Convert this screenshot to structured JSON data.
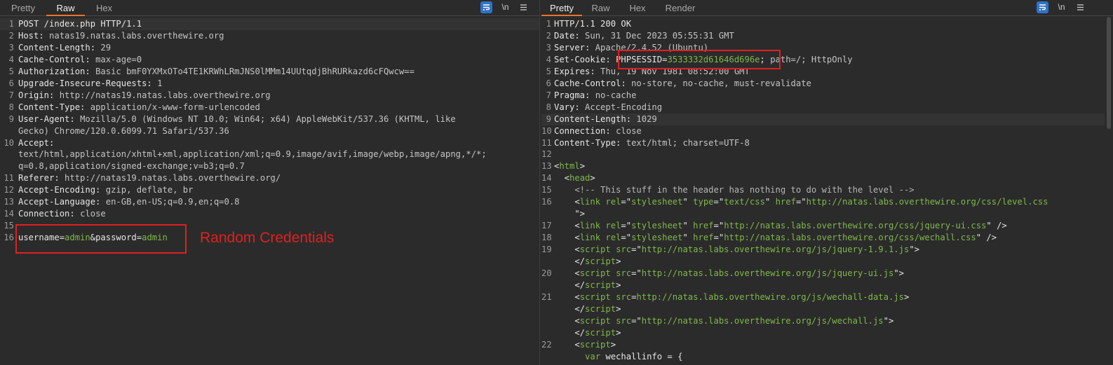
{
  "left": {
    "tabs": [
      "Pretty",
      "Raw",
      "Hex"
    ],
    "active_tab": "Raw",
    "toolbar": {
      "wrap_icon": "wrap-lines-icon",
      "newline_label": "\\n",
      "menu_icon": "hamburger-icon"
    },
    "lines": [
      {
        "n": "1",
        "parts": [
          [
            "k",
            "POST /index.php HTTP/1.1"
          ]
        ]
      },
      {
        "n": "2",
        "parts": [
          [
            "k",
            "Host: "
          ],
          [
            "v",
            "natas19.natas.labs.overthewire.org"
          ]
        ]
      },
      {
        "n": "3",
        "parts": [
          [
            "k",
            "Content-Length: "
          ],
          [
            "v",
            "29"
          ]
        ]
      },
      {
        "n": "4",
        "parts": [
          [
            "k",
            "Cache-Control: "
          ],
          [
            "v",
            "max-age=0"
          ]
        ]
      },
      {
        "n": "5",
        "parts": [
          [
            "k",
            "Authorization: "
          ],
          [
            "v",
            "Basic bmF0YXMxOTo4TE1KRWhLRmJNS0lMMm14UUtqdjBhRURkazd6cFQwcw=="
          ]
        ]
      },
      {
        "n": "6",
        "parts": [
          [
            "k",
            "Upgrade-Insecure-Requests: "
          ],
          [
            "v",
            "1"
          ]
        ]
      },
      {
        "n": "7",
        "parts": [
          [
            "k",
            "Origin: "
          ],
          [
            "v",
            "http://natas19.natas.labs.overthewire.org"
          ]
        ]
      },
      {
        "n": "8",
        "parts": [
          [
            "k",
            "Content-Type: "
          ],
          [
            "v",
            "application/x-www-form-urlencoded"
          ]
        ]
      },
      {
        "n": "9",
        "parts": [
          [
            "k",
            "User-Agent: "
          ],
          [
            "v",
            "Mozilla/5.0 (Windows NT 10.0; Win64; x64) AppleWebKit/537.36 (KHTML, like"
          ]
        ]
      },
      {
        "n": "",
        "parts": [
          [
            "v",
            "Gecko) Chrome/120.0.6099.71 Safari/537.36"
          ]
        ]
      },
      {
        "n": "10",
        "parts": [
          [
            "k",
            "Accept:"
          ]
        ]
      },
      {
        "n": "",
        "parts": [
          [
            "v",
            "text/html,application/xhtml+xml,application/xml;q=0.9,image/avif,image/webp,image/apng,*/*;"
          ]
        ]
      },
      {
        "n": "",
        "parts": [
          [
            "v",
            "q=0.8,application/signed-exchange;v=b3;q=0.7"
          ]
        ]
      },
      {
        "n": "11",
        "parts": [
          [
            "k",
            "Referer: "
          ],
          [
            "v",
            "http://natas19.natas.labs.overthewire.org/"
          ]
        ]
      },
      {
        "n": "12",
        "parts": [
          [
            "k",
            "Accept-Encoding: "
          ],
          [
            "v",
            "gzip, deflate, br"
          ]
        ]
      },
      {
        "n": "13",
        "parts": [
          [
            "k",
            "Accept-Language: "
          ],
          [
            "v",
            "en-GB,en-US;q=0.9,en;q=0.8"
          ]
        ]
      },
      {
        "n": "14",
        "parts": [
          [
            "k",
            "Connection: "
          ],
          [
            "v",
            "close"
          ]
        ]
      },
      {
        "n": "15",
        "parts": []
      },
      {
        "n": "16",
        "parts": [
          [
            "k",
            "username"
          ],
          [
            "t",
            "="
          ],
          [
            "g",
            "admin"
          ],
          [
            "t",
            "&password="
          ],
          [
            "g",
            "admin"
          ]
        ]
      }
    ],
    "annotation": "Random Credentials"
  },
  "right": {
    "tabs": [
      "Pretty",
      "Raw",
      "Hex",
      "Render"
    ],
    "active_tab": "Pretty",
    "toolbar": {
      "wrap_icon": "wrap-lines-icon",
      "newline_label": "\\n",
      "menu_icon": "hamburger-icon"
    },
    "lines": [
      {
        "n": "1",
        "parts": [
          [
            "k",
            "HTTP/1.1 200 OK"
          ]
        ]
      },
      {
        "n": "2",
        "parts": [
          [
            "k",
            "Date: "
          ],
          [
            "v",
            "Sun, 31 Dec 2023 05:55:31 GMT"
          ]
        ]
      },
      {
        "n": "3",
        "parts": [
          [
            "k",
            "Server: "
          ],
          [
            "v",
            "Apache/2.4.52 (Ubuntu)"
          ]
        ]
      },
      {
        "n": "4",
        "parts": [
          [
            "k",
            "Set-Cookie: "
          ],
          [
            "k",
            "PHPSESSID="
          ],
          [
            "g",
            "3533332d61646d696e"
          ],
          [
            "k",
            "; "
          ],
          [
            "v",
            "path=/; HttpOnly"
          ]
        ]
      },
      {
        "n": "5",
        "parts": [
          [
            "k",
            "Expires: "
          ],
          [
            "v",
            "Thu, 19 Nov 1981 08:52:00 GMT"
          ]
        ]
      },
      {
        "n": "6",
        "parts": [
          [
            "k",
            "Cache-Control: "
          ],
          [
            "v",
            "no-store, no-cache, must-revalidate"
          ]
        ]
      },
      {
        "n": "7",
        "parts": [
          [
            "k",
            "Pragma: "
          ],
          [
            "v",
            "no-cache"
          ]
        ]
      },
      {
        "n": "8",
        "parts": [
          [
            "k",
            "Vary: "
          ],
          [
            "v",
            "Accept-Encoding"
          ]
        ]
      },
      {
        "n": "9",
        "parts": [
          [
            "k",
            "Content-Length: "
          ],
          [
            "v",
            "1029"
          ]
        ]
      },
      {
        "n": "10",
        "parts": [
          [
            "k",
            "Connection: "
          ],
          [
            "v",
            "close"
          ]
        ]
      },
      {
        "n": "11",
        "parts": [
          [
            "k",
            "Content-Type: "
          ],
          [
            "v",
            "text/html; charset=UTF-8"
          ]
        ]
      },
      {
        "n": "12",
        "parts": []
      },
      {
        "n": "13",
        "parts": [
          [
            "t",
            "<"
          ],
          [
            "g",
            "html"
          ],
          [
            "t",
            ">"
          ]
        ]
      },
      {
        "n": "14",
        "parts": [
          [
            "t",
            "  <"
          ],
          [
            "g",
            "head"
          ],
          [
            "t",
            ">"
          ]
        ]
      },
      {
        "n": "15",
        "parts": [
          [
            "cm",
            "    <!-- This stuff in the header has nothing to do with the level -->"
          ]
        ]
      },
      {
        "n": "16",
        "parts": [
          [
            "t",
            "    <"
          ],
          [
            "g",
            "link"
          ],
          [
            "t",
            " "
          ],
          [
            "g",
            "rel"
          ],
          [
            "t",
            "=\""
          ],
          [
            "g",
            "stylesheet"
          ],
          [
            "t",
            "\" "
          ],
          [
            "g",
            "type"
          ],
          [
            "t",
            "=\""
          ],
          [
            "g",
            "text/css"
          ],
          [
            "t",
            "\" "
          ],
          [
            "g",
            "href"
          ],
          [
            "t",
            "=\""
          ],
          [
            "g",
            "http://natas.labs.overthewire.org/css/level.css"
          ]
        ]
      },
      {
        "n": "",
        "parts": [
          [
            "t",
            "    \">"
          ]
        ]
      },
      {
        "n": "17",
        "parts": [
          [
            "t",
            "    <"
          ],
          [
            "g",
            "link"
          ],
          [
            "t",
            " "
          ],
          [
            "g",
            "rel"
          ],
          [
            "t",
            "=\""
          ],
          [
            "g",
            "stylesheet"
          ],
          [
            "t",
            "\" "
          ],
          [
            "g",
            "href"
          ],
          [
            "t",
            "=\""
          ],
          [
            "g",
            "http://natas.labs.overthewire.org/css/jquery-ui.css"
          ],
          [
            "t",
            "\" />"
          ]
        ]
      },
      {
        "n": "18",
        "parts": [
          [
            "t",
            "    <"
          ],
          [
            "g",
            "link"
          ],
          [
            "t",
            " "
          ],
          [
            "g",
            "rel"
          ],
          [
            "t",
            "=\""
          ],
          [
            "g",
            "stylesheet"
          ],
          [
            "t",
            "\" "
          ],
          [
            "g",
            "href"
          ],
          [
            "t",
            "=\""
          ],
          [
            "g",
            "http://natas.labs.overthewire.org/css/wechall.css"
          ],
          [
            "t",
            "\" />"
          ]
        ]
      },
      {
        "n": "19",
        "parts": [
          [
            "t",
            "    <"
          ],
          [
            "g",
            "script"
          ],
          [
            "t",
            " "
          ],
          [
            "g",
            "src"
          ],
          [
            "t",
            "=\""
          ],
          [
            "g",
            "http://natas.labs.overthewire.org/js/jquery-1.9.1.js"
          ],
          [
            "t",
            "\">"
          ]
        ]
      },
      {
        "n": "",
        "parts": [
          [
            "t",
            "    </"
          ],
          [
            "g",
            "script"
          ],
          [
            "t",
            ">"
          ]
        ]
      },
      {
        "n": "20",
        "parts": [
          [
            "t",
            "    <"
          ],
          [
            "g",
            "script"
          ],
          [
            "t",
            " "
          ],
          [
            "g",
            "src"
          ],
          [
            "t",
            "=\""
          ],
          [
            "g",
            "http://natas.labs.overthewire.org/js/jquery-ui.js"
          ],
          [
            "t",
            "\">"
          ]
        ]
      },
      {
        "n": "",
        "parts": [
          [
            "t",
            "    </"
          ],
          [
            "g",
            "script"
          ],
          [
            "t",
            ">"
          ]
        ]
      },
      {
        "n": "21",
        "parts": [
          [
            "t",
            "    <"
          ],
          [
            "g",
            "script"
          ],
          [
            "t",
            " "
          ],
          [
            "g",
            "src"
          ],
          [
            "t",
            "="
          ],
          [
            "g",
            "http://natas.labs.overthewire.org/js/wechall-data.js"
          ],
          [
            "t",
            ">"
          ]
        ]
      },
      {
        "n": "",
        "parts": [
          [
            "t",
            "    </"
          ],
          [
            "g",
            "script"
          ],
          [
            "t",
            ">"
          ]
        ]
      },
      {
        "n": "",
        "parts": [
          [
            "t",
            "    <"
          ],
          [
            "g",
            "script"
          ],
          [
            "t",
            " "
          ],
          [
            "g",
            "src"
          ],
          [
            "t",
            "=\""
          ],
          [
            "g",
            "http://natas.labs.overthewire.org/js/wechall.js"
          ],
          [
            "t",
            "\">"
          ]
        ]
      },
      {
        "n": "",
        "parts": [
          [
            "t",
            "    </"
          ],
          [
            "g",
            "script"
          ],
          [
            "t",
            ">"
          ]
        ]
      },
      {
        "n": "22",
        "parts": [
          [
            "t",
            "    <"
          ],
          [
            "g",
            "script"
          ],
          [
            "t",
            ">"
          ]
        ]
      },
      {
        "n": "",
        "parts": [
          [
            "t",
            "      "
          ],
          [
            "g",
            "var"
          ],
          [
            "t",
            " wechallinfo = {"
          ]
        ]
      }
    ]
  }
}
